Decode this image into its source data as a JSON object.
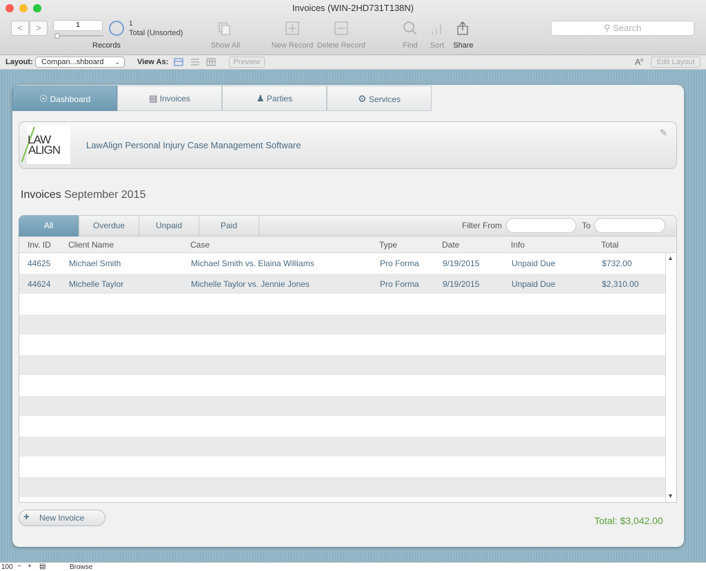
{
  "window": {
    "title": "Invoices (WIN-2HD731T138N)"
  },
  "toolbar": {
    "back_glyph": "<",
    "forward_glyph": ">",
    "record_number": "1",
    "found_count": "1",
    "found_status": "Total (Unsorted)",
    "records_label": "Records",
    "show_all_label": "Show All",
    "new_record_label": "New Record",
    "delete_record_label": "Delete Record",
    "find_label": "Find",
    "sort_label": "Sort",
    "share_label": "Share",
    "search_placeholder": "Search",
    "icons": {
      "show_all": "show-all-icon",
      "new_record": "plus-square-icon",
      "delete_record": "minus-square-icon",
      "find": "magnifier-icon",
      "sort": "sort-bars-icon",
      "share": "share-icon"
    }
  },
  "layout_bar": {
    "layout_label": "Layout:",
    "layout_value": "Compan...shboard",
    "view_as_label": "View As:",
    "preview_label": "Preview",
    "edit_layout_label": "Edit Layout"
  },
  "tabs": [
    {
      "label": "Dashboard",
      "icon": "compass-icon",
      "active": true
    },
    {
      "label": "Invoices",
      "icon": "invoice-icon",
      "active": false
    },
    {
      "label": "Parties",
      "icon": "person-icon",
      "active": false
    },
    {
      "label": "Services",
      "icon": "gear-icon",
      "active": false
    }
  ],
  "header": {
    "logo_line1": "LAW",
    "logo_line2": "ALIGN",
    "app_title": "LawAlign Personal Injury Case Management Software"
  },
  "section": {
    "title_bold": "Invoices",
    "title_period": "September 2015"
  },
  "filters": {
    "tabs": [
      "All",
      "Overdue",
      "Unpaid",
      "Paid"
    ],
    "active": "All",
    "filter_from_label": "Filter From",
    "to_label": "To",
    "filter_from_value": "",
    "to_value": ""
  },
  "columns": [
    "Inv. ID",
    "Client Name",
    "Case",
    "Type",
    "Date",
    "Info",
    "Total"
  ],
  "invoices": [
    {
      "id": "44625",
      "client": "Michael Smith",
      "case": "Michael Smith vs. Elaina Williams",
      "type": "Pro Forma",
      "date": "9/19/2015",
      "info": "Unpaid Due",
      "total": "$732.00"
    },
    {
      "id": "44624",
      "client": "Michelle Taylor",
      "case": "Michelle Taylor vs. Jennie Jones",
      "type": "Pro Forma",
      "date": "9/19/2015",
      "info": "Unpaid Due",
      "total": "$2,310.00"
    }
  ],
  "footer": {
    "new_invoice_label": "New Invoice",
    "grand_total": "Total: $3,042.00"
  },
  "statusbar": {
    "zoom": "100",
    "mode": "Browse"
  },
  "colors": {
    "accent": "#6d99b0",
    "link_text": "#4a6c85",
    "total_green": "#5a9e3a",
    "logo_green": "#7bc24a"
  }
}
